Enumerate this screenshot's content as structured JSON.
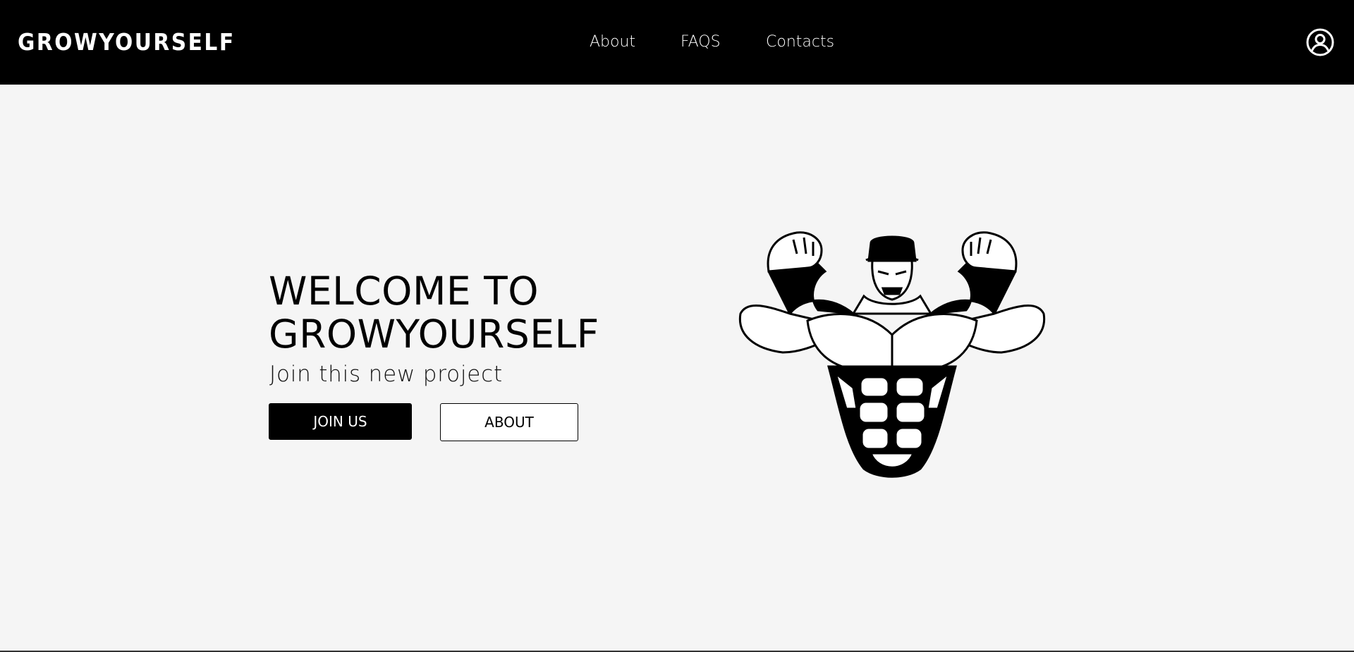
{
  "navbar": {
    "logo": "GROWYOURSELF",
    "links": [
      {
        "label": "About"
      },
      {
        "label": "FAQS"
      },
      {
        "label": "Contacts"
      }
    ],
    "user_icon": "user-circle-icon"
  },
  "hero": {
    "title_line1": "WELCOME TO",
    "title_line2": "GROWYOURSELF",
    "subtitle": "Join this new project",
    "join_button": "JOIN US",
    "about_button": "ABOUT",
    "image_icon": "bodybuilder-mascot"
  },
  "colors": {
    "navbar_bg": "#000000",
    "page_bg": "#f5f5f5",
    "primary_button_bg": "#000000",
    "secondary_button_bg": "#ffffff"
  }
}
